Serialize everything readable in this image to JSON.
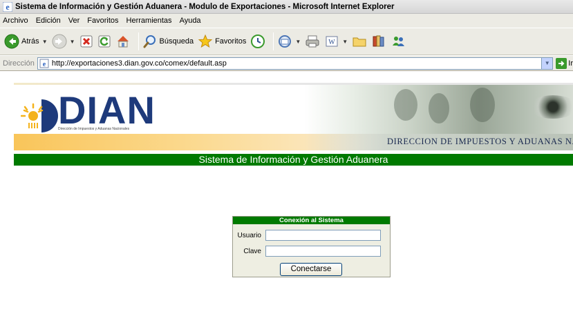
{
  "window": {
    "title": "Sistema de Información y Gestión Aduanera - Modulo de Exportaciones - Microsoft Internet Explorer"
  },
  "menu": {
    "items": [
      "Archivo",
      "Edición",
      "Ver",
      "Favoritos",
      "Herramientas",
      "Ayuda"
    ]
  },
  "toolbar": {
    "back_label": "Atrás",
    "search_label": "Búsqueda",
    "favorites_label": "Favoritos"
  },
  "address": {
    "label": "Dirección",
    "url": "http://exportaciones3.dian.gov.co/comex/default.asp",
    "go_label": "Ir"
  },
  "banner": {
    "logo": "DIAN",
    "subtitle": "Dirección de Impuestos y Aduanas Nacionales",
    "tagline": "DIRECCION DE IMPUESTOS Y ADUANAS NACIONALES"
  },
  "system_title": "Sistema de Información y Gestión Aduanera",
  "login": {
    "heading": "Conexión al Sistema",
    "user_label": "Usuario",
    "user_value": "",
    "password_label": "Clave",
    "password_value": "",
    "submit_label": "Conectarse"
  },
  "colors": {
    "green": "#007a00",
    "dian_blue": "#1e3a7b",
    "orange": "#f9c55a"
  }
}
